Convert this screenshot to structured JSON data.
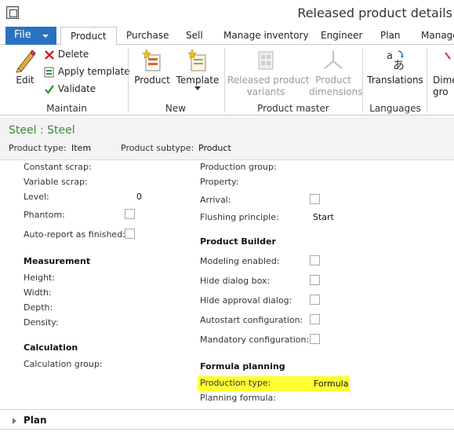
{
  "window": {
    "title": "Released product details"
  },
  "tabs": {
    "file": "File",
    "items": [
      "Product",
      "Purchase",
      "Sell",
      "Manage inventory",
      "Engineer",
      "Plan",
      "Manage"
    ]
  },
  "ribbon": {
    "maintain": {
      "label": "Maintain",
      "edit": "Edit",
      "delete": "Delete",
      "apply_template": "Apply template",
      "validate": "Validate"
    },
    "new": {
      "label": "New",
      "product": "Product",
      "template": "Template"
    },
    "product_master": {
      "label": "Product master",
      "released_variants_line1": "Released product",
      "released_variants_line2": "variants",
      "dimensions_line1": "Product",
      "dimensions_line2": "dimensions"
    },
    "languages": {
      "label": "Languages",
      "translations": "Translations"
    },
    "cut": {
      "line1": "Dime",
      "line2": "gro"
    }
  },
  "header": {
    "record_title": "Steel : Steel",
    "product_type_label": "Product type:",
    "product_type_value": "Item",
    "product_subtype_label": "Product subtype:",
    "product_subtype_value": "Product"
  },
  "form": {
    "left": {
      "constant_scrap": "Constant scrap:",
      "variable_scrap": "Variable scrap:",
      "level_label": "Level:",
      "level_value": "0",
      "phantom": "Phantom:",
      "phantom_checked": false,
      "auto_report": "Auto-report as finished:",
      "auto_report_checked": false,
      "measurement_head": "Measurement",
      "height": "Height:",
      "width": "Width:",
      "depth": "Depth:",
      "density": "Density:",
      "calculation_head": "Calculation",
      "calculation_group": "Calculation group:"
    },
    "right": {
      "production_group": "Production group:",
      "property": "Property:",
      "arrival": "Arrival:",
      "arrival_checked": false,
      "flushing_label": "Flushing principle:",
      "flushing_value": "Start",
      "product_builder_head": "Product Builder",
      "modeling_enabled": "Modeling enabled:",
      "hide_dialog_box": "Hide dialog box:",
      "hide_approval_dialog": "Hide approval dialog:",
      "autostart_configuration": "Autostart configuration:",
      "mandatory_configuration": "Mandatory configuration:",
      "formula_planning_head": "Formula planning",
      "production_type_label": "Production type:",
      "production_type_value": "Formula",
      "planning_formula": "Planning formula:"
    }
  },
  "plan_section": {
    "label": "Plan"
  },
  "colors": {
    "file_tab": "#2a72c1",
    "title_green": "#3a8a3a",
    "highlight": "#ffff33"
  }
}
